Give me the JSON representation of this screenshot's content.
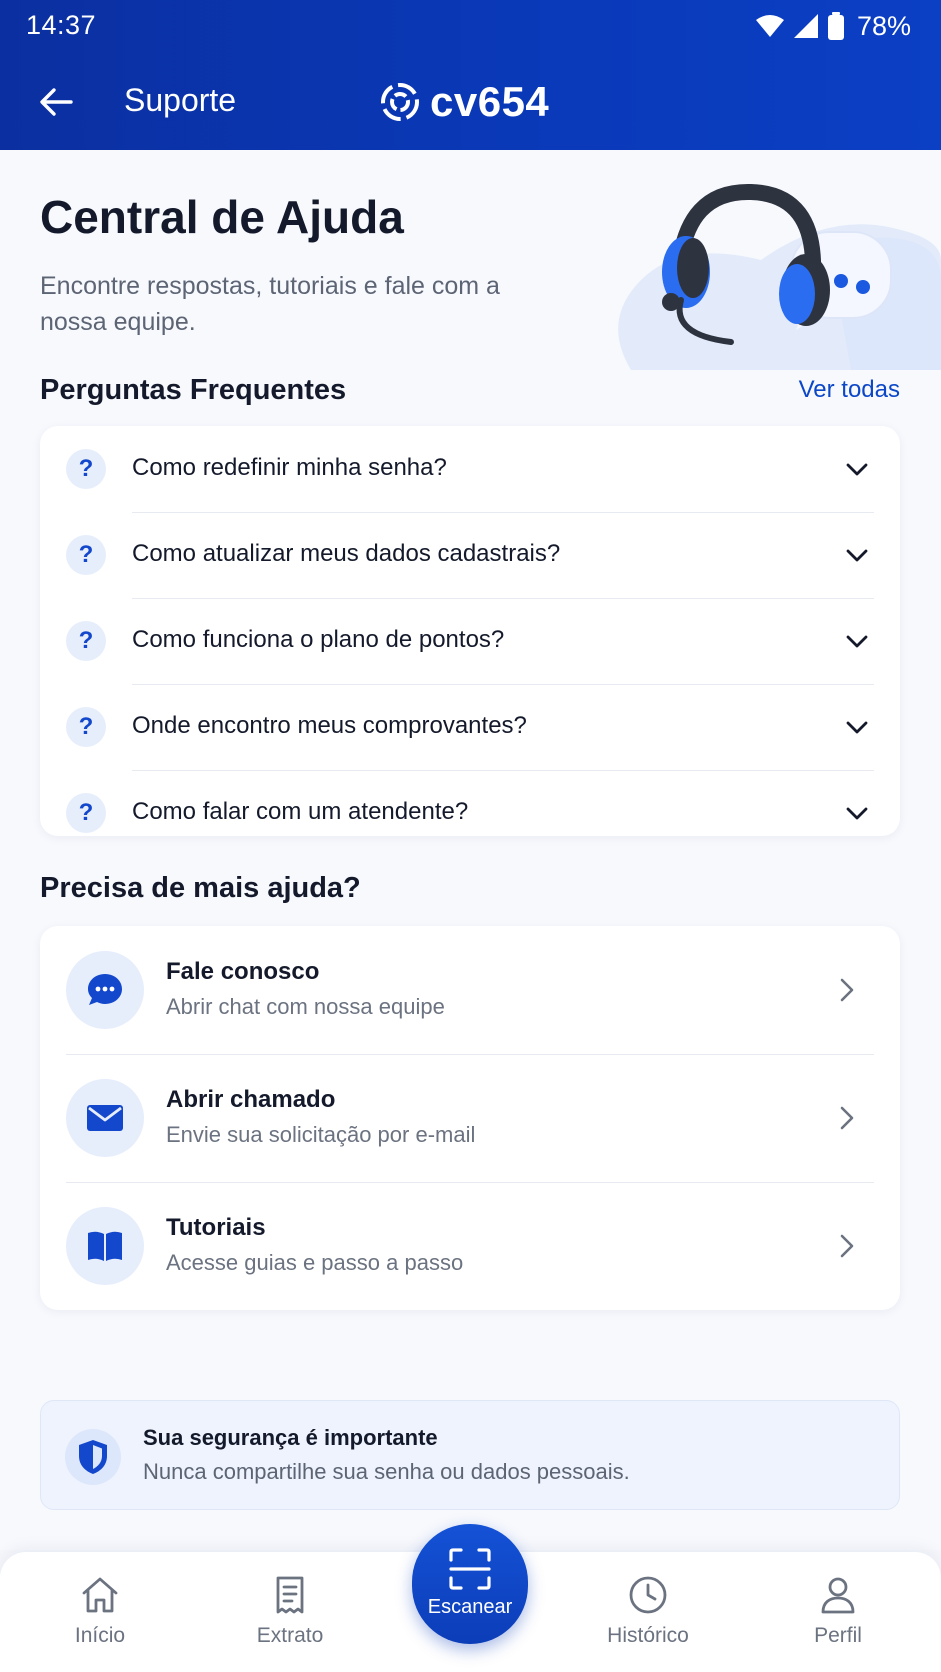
{
  "status_bar": {
    "time": "14:37",
    "battery": "78%",
    "icons": [
      "wifi-icon",
      "signal-icon",
      "battery-icon"
    ]
  },
  "app_bar": {
    "back_icon": "arrow-left-icon",
    "title": "Suporte",
    "brand_name": "cv654",
    "brand_icon": "brand-logo-icon"
  },
  "hero": {
    "title": "Central de Ajuda",
    "subtitle": "Encontre respostas, tutoriais e fale com a nossa equipe.",
    "illustration": "headset-chat-illustration"
  },
  "faq": {
    "title": "Perguntas Frequentes",
    "see_all": "Ver todas",
    "items": [
      {
        "label": "Como redefinir minha senha?",
        "icon": "question-icon"
      },
      {
        "label": "Como atualizar meus dados cadastrais?",
        "icon": "question-icon"
      },
      {
        "label": "Como funciona o plano de pontos?",
        "icon": "question-icon"
      },
      {
        "label": "Onde encontro meus comprovantes?",
        "icon": "question-icon"
      },
      {
        "label": "Como falar com um atendente?",
        "icon": "question-icon"
      }
    ],
    "question_mark": "?"
  },
  "help": {
    "title": "Precisa de mais ajuda?",
    "items": [
      {
        "title": "Fale conosco",
        "subtitle": "Abrir chat com nossa equipe",
        "icon": "chat-icon"
      },
      {
        "title": "Abrir chamado",
        "subtitle": "Envie sua solicitação por e-mail",
        "icon": "mail-icon"
      },
      {
        "title": "Tutoriais",
        "subtitle": "Acesse guias e passo a passo",
        "icon": "book-icon"
      }
    ]
  },
  "security": {
    "title": "Sua segurança é importante",
    "subtitle": "Nunca compartilhe sua senha ou dados pessoais.",
    "icon": "shield-icon"
  },
  "bottom_nav": {
    "items": [
      {
        "label": "Início",
        "icon": "home-icon"
      },
      {
        "label": "Extrato",
        "icon": "receipt-icon"
      },
      {
        "label": "Escanear",
        "icon": "scan-icon"
      },
      {
        "label": "Histórico",
        "icon": "clock-icon"
      },
      {
        "label": "Perfil",
        "icon": "user-icon"
      }
    ]
  },
  "colors": {
    "primary": "#0b39b8",
    "accent": "#0c47c8",
    "text": "#141a2b",
    "muted": "#6b7280",
    "icon_bg": "#e6eefc"
  }
}
